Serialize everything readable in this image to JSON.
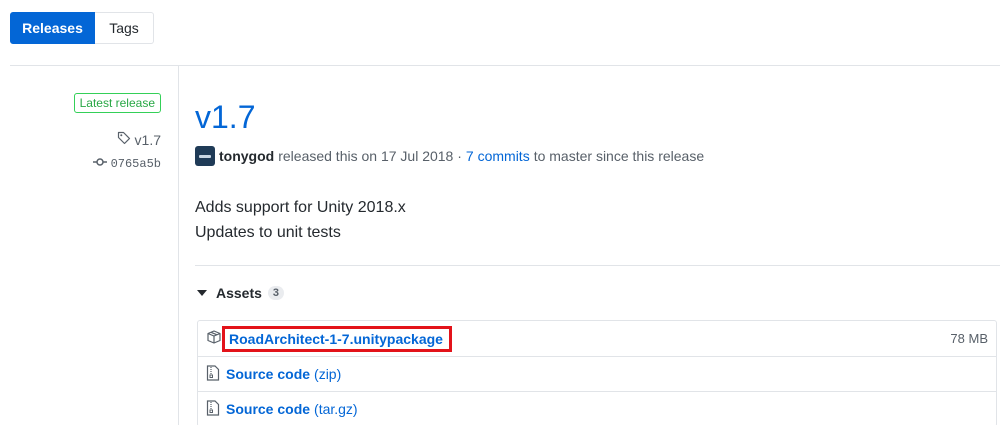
{
  "tabs": [
    {
      "label": "Releases",
      "active": true
    },
    {
      "label": "Tags",
      "active": false
    }
  ],
  "sidebar": {
    "latest_label": "Latest release",
    "tag": "v1.7",
    "commit": "0765a5b"
  },
  "release": {
    "title": "v1.7",
    "author": "tonygod",
    "released_text": "released this on 17 Jul 2018 ·",
    "commits_link": "7 commits",
    "since_text": "to master since this release",
    "notes": [
      "Adds support for Unity 2018.x",
      "Updates to unit tests"
    ]
  },
  "assets": {
    "label": "Assets",
    "count": "3",
    "items": [
      {
        "name": "RoadArchitect-1-7.unitypackage",
        "suffix": "",
        "size": "78 MB",
        "icon": "package-icon",
        "highlighted": true
      },
      {
        "name": "Source code",
        "suffix": "(zip)",
        "size": "",
        "icon": "file-zip-icon"
      },
      {
        "name": "Source code",
        "suffix": "(tar.gz)",
        "size": "",
        "icon": "file-zip-icon"
      }
    ]
  },
  "colors": {
    "accent": "#0366d6",
    "latest_badge": "#28a745",
    "highlight_box": "#e3131a"
  }
}
